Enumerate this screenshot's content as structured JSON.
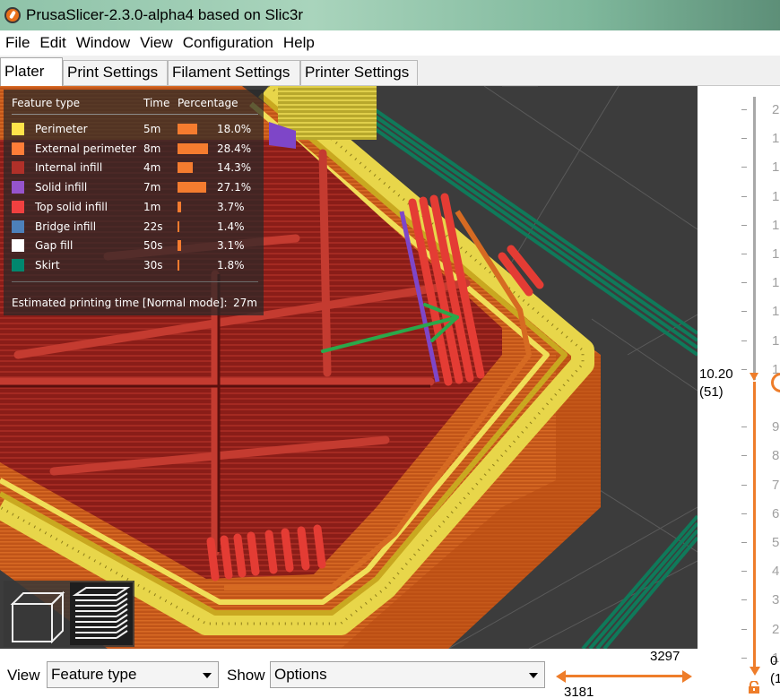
{
  "window": {
    "title": "PrusaSlicer-2.3.0-alpha4 based on Slic3r"
  },
  "menu": [
    "File",
    "Edit",
    "Window",
    "View",
    "Configuration",
    "Help"
  ],
  "tabs": [
    {
      "label": "Plater",
      "active": true
    },
    {
      "label": "Print Settings",
      "active": false
    },
    {
      "label": "Filament Settings",
      "active": false
    },
    {
      "label": "Printer Settings",
      "active": false
    }
  ],
  "legend": {
    "headers": {
      "feature": "Feature type",
      "time": "Time",
      "percentage": "Percentage"
    },
    "rows": [
      {
        "label": "Perimeter",
        "color": "#ffe34a",
        "time": "5m",
        "percent": "18.0%",
        "fraction": 0.18
      },
      {
        "label": "External perimeter",
        "color": "#ff7d38",
        "time": "8m",
        "percent": "28.4%",
        "fraction": 0.284
      },
      {
        "label": "Internal infill",
        "color": "#b03029",
        "time": "4m",
        "percent": "14.3%",
        "fraction": 0.143
      },
      {
        "label": "Solid infill",
        "color": "#9654cc",
        "time": "7m",
        "percent": "27.1%",
        "fraction": 0.271
      },
      {
        "label": "Top solid infill",
        "color": "#f04040",
        "time": "1m",
        "percent": "3.7%",
        "fraction": 0.037
      },
      {
        "label": "Bridge infill",
        "color": "#4d80ba",
        "time": "22s",
        "percent": "1.4%",
        "fraction": 0.014
      },
      {
        "label": "Gap fill",
        "color": "#ffffff",
        "time": "50s",
        "percent": "3.1%",
        "fraction": 0.031
      },
      {
        "label": "Skirt",
        "color": "#00876e",
        "time": "30s",
        "percent": "1.8%",
        "fraction": 0.018
      }
    ],
    "estimate_label": "Estimated printing time [Normal mode]:",
    "estimate_value": "27m"
  },
  "vertical_slider": {
    "current_height": "10.20",
    "current_layer": "(51)",
    "bottom_value": "0",
    "bottom_layer": "(1",
    "tick_labels": [
      "2",
      "1",
      "1",
      "1",
      "1",
      "1",
      "1",
      "1",
      "1",
      "1",
      "1",
      "9",
      "8",
      "7",
      "6",
      "5",
      "4",
      "3",
      "2",
      "1"
    ]
  },
  "bottom_bar": {
    "view_label": "View",
    "view_value": "Feature type",
    "show_label": "Show",
    "show_value": "Options",
    "h_slider_top": "3297",
    "h_slider_bottom": "3181"
  },
  "colors": {
    "accent": "#ee7d2a",
    "annotation_arrow": "#2aa84a",
    "ground": "#3c3c3c"
  },
  "icons": {
    "app": "prusaslicer-logo-icon",
    "view_3d": "cube-icon",
    "view_layers": "layers-icon",
    "lock": "lock-icon",
    "dropdown": "chevron-down-icon"
  }
}
